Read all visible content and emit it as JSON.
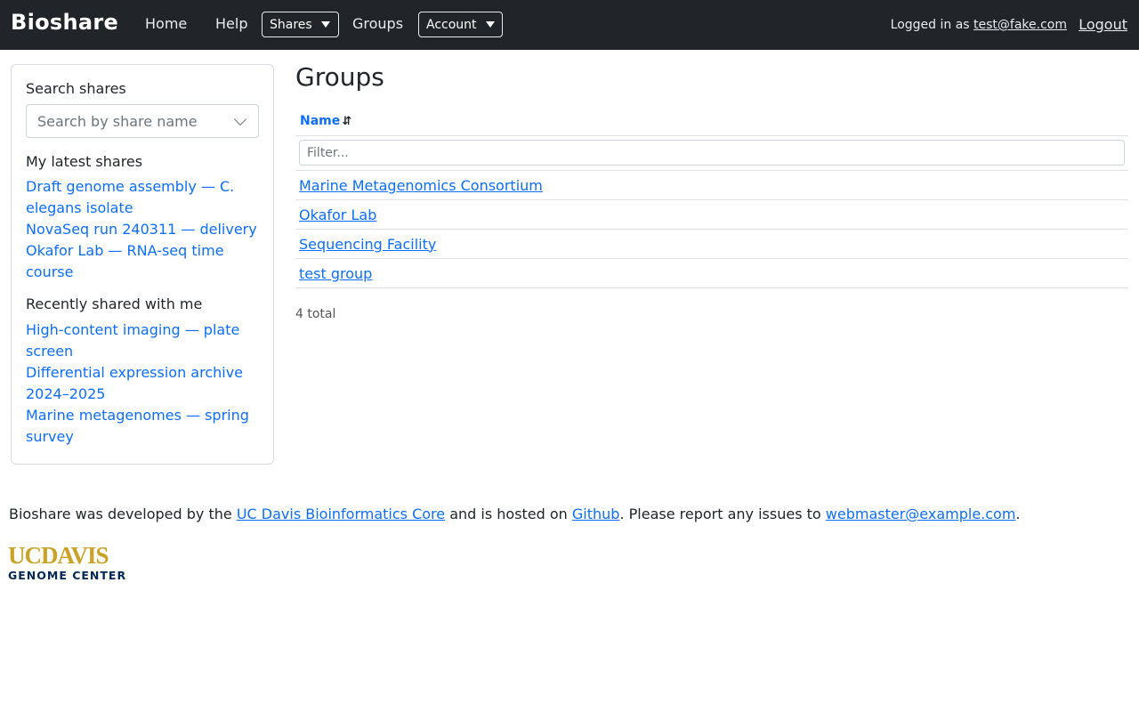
{
  "navbar": {
    "brand": "Bioshare",
    "home": "Home",
    "help": "Help",
    "shares": "Shares",
    "groups": "Groups",
    "account": "Account",
    "logged_in_prefix": "Logged in as",
    "user": "test@fake.com",
    "logout": "Logout"
  },
  "sidebar": {
    "search_label": "Search shares",
    "search_placeholder": "Search by share name",
    "latest_heading": "My latest shares",
    "latest": [
      "Draft genome assembly — C. elegans isolate",
      "NovaSeq run 240311 — delivery",
      "Okafor Lab — RNA-seq time course"
    ],
    "shared_heading": "Recently shared with me",
    "shared": [
      "High-content imaging — plate screen",
      "Differential expression archive 2024–2025",
      "Marine metagenomes — spring survey"
    ]
  },
  "main": {
    "title": "Groups",
    "column_name": "Name",
    "sort_icon": "⇵",
    "filter_placeholder": "Filter...",
    "rows": [
      "Marine Metagenomics Consortium",
      "Okafor Lab",
      "Sequencing Facility",
      "test group"
    ],
    "total": "4 total"
  },
  "footer": {
    "t1": "Bioshare was developed by the ",
    "link1": "UC Davis Bioinformatics Core",
    "t2": " and is hosted on ",
    "link2": "Github",
    "t3": ". Please report any issues to ",
    "link3": "webmaster@example.com",
    "t4": "."
  },
  "logo": {
    "line1": "UCDAVIS",
    "line2": "GENOME CENTER",
    "gold": "#c9a227",
    "navy": "#002855"
  }
}
